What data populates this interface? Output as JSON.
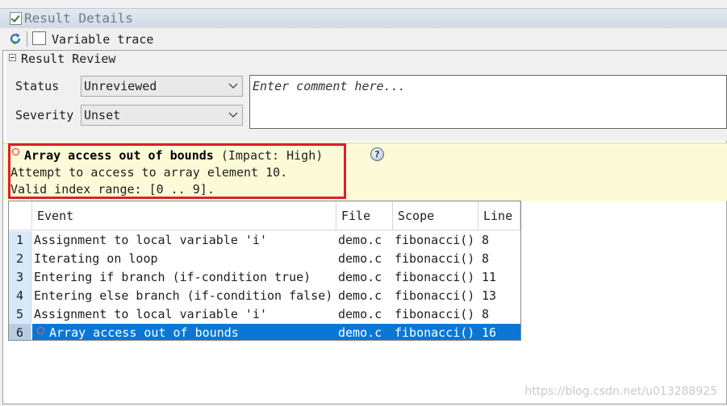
{
  "window": {
    "title": "Result Details"
  },
  "toolbar": {
    "variable_trace_label": "Variable trace",
    "variable_trace_checked": false
  },
  "review": {
    "section_title": "Result Review",
    "status_label": "Status",
    "status_value": "Unreviewed",
    "severity_label": "Severity",
    "severity_value": "Unset",
    "comment_placeholder": "Enter comment here..."
  },
  "issue": {
    "title": "Array access out of bounds",
    "impact": "(Impact: High)",
    "description_line1": "Attempt to access to array element 10.",
    "description_line2": "Valid index range: [0 .. 9]."
  },
  "events_table": {
    "columns": {
      "event": "Event",
      "file": "File",
      "scope": "Scope",
      "line": "Line"
    },
    "rows": [
      {
        "num": "1",
        "event": "Assignment to local variable 'i'",
        "file": "demo.c",
        "scope": "fibonacci()",
        "line": "8"
      },
      {
        "num": "2",
        "event": "Iterating on loop",
        "file": "demo.c",
        "scope": "fibonacci()",
        "line": "8"
      },
      {
        "num": "3",
        "event": "Entering if branch (if-condition true)",
        "file": "demo.c",
        "scope": "fibonacci()",
        "line": "11"
      },
      {
        "num": "4",
        "event": "Entering else branch (if-condition false)",
        "file": "demo.c",
        "scope": "fibonacci()",
        "line": "13"
      },
      {
        "num": "5",
        "event": "Assignment to local variable 'i'",
        "file": "demo.c",
        "scope": "fibonacci()",
        "line": "8"
      },
      {
        "num": "6",
        "event": "Array access out of bounds",
        "file": "demo.c",
        "scope": "fibonacci()",
        "line": "16"
      }
    ],
    "selected_row": "6"
  },
  "watermark": "https://blog.csdn.net/u013288925",
  "colors": {
    "selection": "#0a77d6",
    "issue_background": "#fdfbd7",
    "highlight_border": "#d9222a",
    "row_number_bg": "#d7e8f7"
  }
}
